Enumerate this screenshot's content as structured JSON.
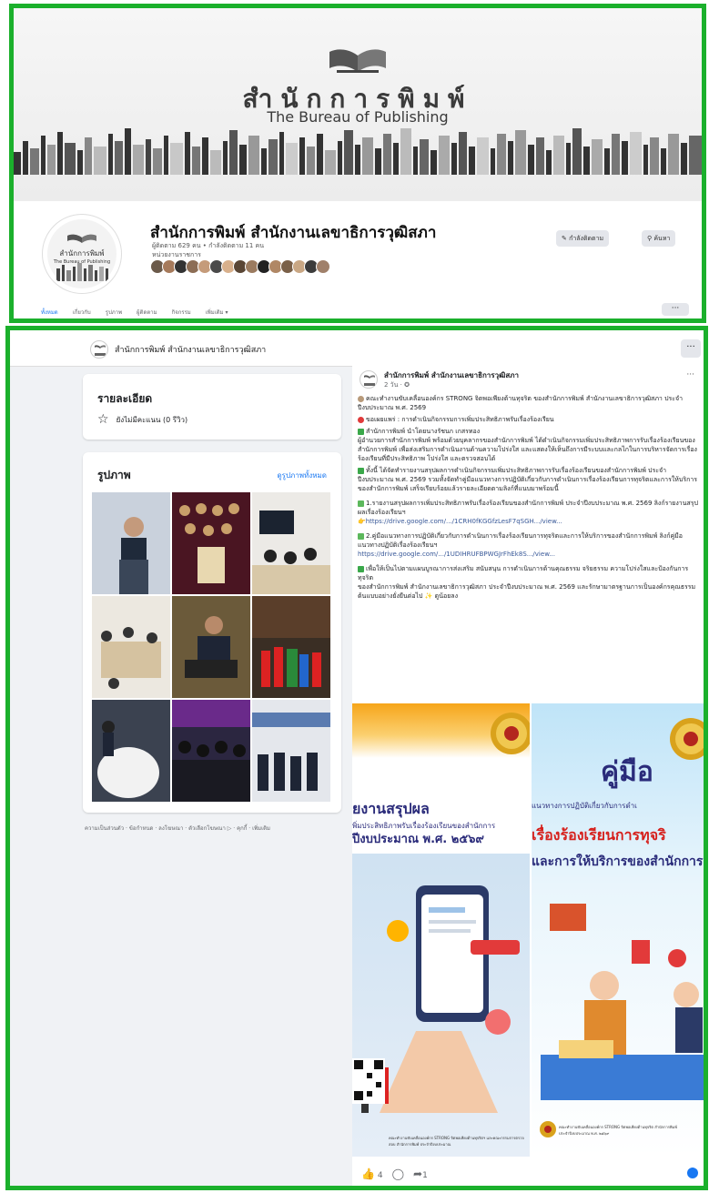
{
  "cover": {
    "title_th": "สำนักการพิมพ์",
    "title_en": "The Bureau of Publishing"
  },
  "profile": {
    "name": "สำนักการพิมพ์ สำนักงานเลขาธิการวุฒิสภา",
    "meta_followers": "ผู้ติดตาม 629 คน • กำลังติดตาม 11 คน",
    "meta_category": "หน่วยงานราชการ",
    "btn_following": "กำลังติดตาม",
    "btn_search": "ค้นหา",
    "tabs": [
      "ทั้งหมด",
      "เกี่ยวกับ",
      "รูปภาพ",
      "ผู้ติดตาม",
      "กิจกรรม",
      "เพิ่มเติม ▾"
    ],
    "more": "···"
  },
  "header": {
    "name": "สำนักการพิมพ์ สำนักงานเลขาธิการวุฒิสภา",
    "more": "···"
  },
  "details": {
    "title": "รายละเอียด",
    "rating": "ยังไม่มีคะแนน (0 รีวิว)"
  },
  "photos": {
    "title": "รูปภาพ",
    "link": "ดูรูปภาพทั้งหมด"
  },
  "footer": "ความเป็นส่วนตัว · ข้อกำหนด · ลงโฆษณา · ตัวเลือกโฆษณา ▷ · คุกกี้ · เพิ่มเติม",
  "post": {
    "author": "สำนักการพิมพ์ สำนักงานเลขาธิการวุฒิสภา",
    "time": "2 วัน · ✪",
    "dots": "···",
    "p1": "คณะทำงานขับเคลื่อนองค์กร STRONG จิตพอเพียงต้านทุจริต ของสำนักการพิมพ์ สำนักงานเลขาธิการวุฒิสภา ประจำปีงบประมาณ พ.ศ. 2569",
    "p2": "ขอเผยแพร่ : การดำเนินกิจกรรมการเพิ่มประสิทธิภาพรับเรื่องร้องเรียน",
    "p3": "สำนักการพิมพ์ นำโดยนางรัชนก  เกสรทอง",
    "p4": "ผู้อำนวยการสำนักการพิมพ์ พร้อมด้วยบุคลากรของสำนักการพิมพ์ ได้ดำเนินกิจกรรมเพิ่มประสิทธิภาพการรับเรื่องร้องเรียนของสำนักการพิมพ์ เพื่อส่งเสริมการดำเนินงานด้านความโปร่งใส และแสดงให้เห็นถึงการมีระบบและกลไกในการบริหารจัดการเรื่องร้องเรียนที่มีประสิทธิภาพ โปร่งใส และตรวจสอบได้",
    "p5": "ทั้งนี้ ได้จัดทำรายงานสรุปผลการดำเนินกิจกรรมเพิ่มประสิทธิภาพการรับเรื่องร้องเรียนของสำนักการพิมพ์ ประจำปีงบประมาณ พ.ศ. 2569 รวมทั้งจัดทำคู่มือแนวทางการปฏิบัติเกี่ยวกับการดำเนินการเรื่องร้องเรียนการทุจริตและการให้บริการของสำนักการพิมพ์ เสร็จเรียบร้อยแล้วรายละเอียดตามลิงก์ที่แนบมาพร้อมนี้",
    "p6": "1.รายงานสรุปผลการเพิ่มประสิทธิภาพรับเรื่องร้องเรียนของสำนักการพิมพ์ ประจำปีงบประมาณ พ.ศ. 2569 ลิงก์รายงานสรุปผลเรื่องร้องเรียนฯ",
    "link1": "https://drive.google.com/.../1CRH0fKGGfzLesF7qSGH.../view...",
    "p7": "2.คู่มือแนวทางการปฏิบัติเกี่ยวกับการดำเนินการเรื่องร้องเรียนการทุจริตและการให้บริการของสำนักการพิมพ์ ลิงก์คู่มือแนวทางปฏิบัติเรื่องร้องเรียนฯ",
    "link2": "https://drive.google.com/.../1UDIHRUFBPWGJrFhEk8S.../view...",
    "p8": "เพื่อให้เป็นไปตามแผนบูรณาการส่งเสริม สนับสนุน การดำเนินการด้านคุณธรรม จริยธรรม ความโปร่งใสและป้องกันการทุจริต",
    "p9": "ของสำนักการพิมพ์ สำนักงานเลขาธิการวุฒิสภา ประจำปีงบประมาณ พ.ศ. 2569 และรักษามาตรฐานการเป็นองค์กรคุณธรรมต้นแบบอย่างยั่งยืนต่อไป ✨ ดูน้อยลง",
    "image1": {
      "line1": "ยงานสรุปผล",
      "line2": "พิ่มประสิทธิภาพรับเรื่องร้องเรียนของสำนักการ",
      "line3": "ปีงบประมาณ พ.ศ. ๒๕๖๙",
      "foot": "คณะทำงานขับเคลื่อนองค์กร STRONG จิตพอเพียงต้านทุจริตฯ และคณะกรรมการตรวจสอบ สำนักการพิมพ์ ประจำปีงบประมาณ"
    },
    "image2": {
      "line1": "คู่มือ",
      "line2": "แนวทางการปฏิบัติเกี่ยวกับการดำเ",
      "line3": "เรื่องร้องเรียนการทุจริ",
      "line4": "และการให้บริการของสำนักการ",
      "foot": "คณะทำงานขับเคลื่อนองค์กร STRONG จิตพอเพียงต้านทุจริต สำนักการพิมพ์ ประจำปีงบประมาณ พ.ศ. ๒๕๖๙"
    },
    "likes": "4",
    "shares": "1"
  }
}
